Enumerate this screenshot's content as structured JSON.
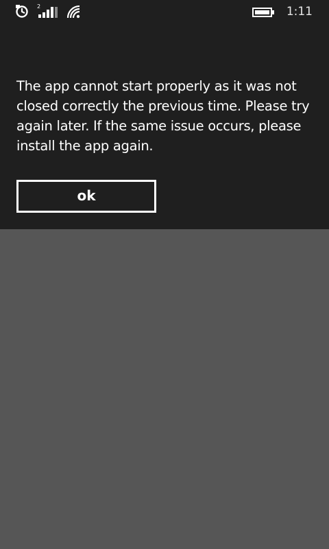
{
  "status_bar": {
    "time": "1:11",
    "signal_sim_number": "2",
    "icons": [
      "app-notification-icon",
      "cellular-signal-icon",
      "wifi-icon",
      "battery-icon"
    ]
  },
  "dialog": {
    "message": "The app cannot start properly as it was not closed correctly the previous time. Please try again later. If the same issue occurs, please install the app again.",
    "ok_label": "ok"
  },
  "colors": {
    "dialog_background": "#1f1f1f",
    "overlay_background": "#565656",
    "text": "#ffffff"
  }
}
